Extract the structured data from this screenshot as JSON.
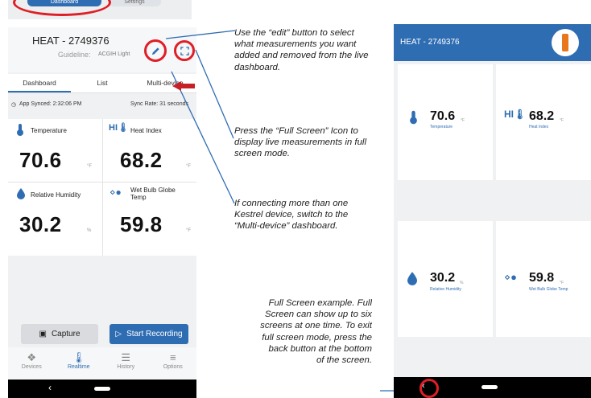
{
  "top_fragment": {
    "tab1": "Dashboard",
    "tab2": "Settings"
  },
  "app": {
    "title": "HEAT - 2749376",
    "guideline_label": "Guideline:",
    "guideline_value": "ACGIH Light",
    "tabs": [
      "Dashboard",
      "List",
      "Multi-device"
    ],
    "app_synced": "App Synced: 2:32:06 PM",
    "sync_rate": "Sync Rate: 31 seconds",
    "measurements": [
      {
        "label": "Temperature",
        "value": "70.6",
        "unit": "°F"
      },
      {
        "label": "Heat Index",
        "value": "68.2",
        "unit": "°F"
      },
      {
        "label": "Relative Humidity",
        "value": "30.2",
        "unit": "%"
      },
      {
        "label": "Wet Bulb Globe Temp",
        "value": "59.8",
        "unit": "°F"
      }
    ],
    "capture_label": "Capture",
    "record_label": "Start Recording",
    "nav": [
      "Devices",
      "Realtime",
      "History",
      "Options"
    ],
    "back_glyph": "‹"
  },
  "annotations": {
    "edit": "Use the “edit” button to select what measurements you want added and removed from the live dashboard.",
    "fullscreen": "Press the “Full Screen” Icon to display live measurements in full screen mode.",
    "multidevice": "If connecting more than one Kestrel device, switch to the “Multi-device” dashboard.",
    "example": "Full Screen example. Full Screen can show up to six screens at one time. To exit full screen mode, press the back button at the bottom of the screen."
  },
  "fullscreen": {
    "title": "HEAT - 2749376",
    "tiles": [
      {
        "value": "70.6",
        "unit": "°F",
        "label": "Temperature"
      },
      {
        "value": "68.2",
        "unit": "°F",
        "label": "Heat Index"
      },
      {
        "value": "30.2",
        "unit": "%",
        "label": "Relative Humidity"
      },
      {
        "value": "59.8",
        "unit": "°F",
        "label": "Wet Bulb Globe Temp"
      }
    ]
  },
  "colors": {
    "accent": "#2f6db3",
    "highlight": "#e01e26"
  }
}
